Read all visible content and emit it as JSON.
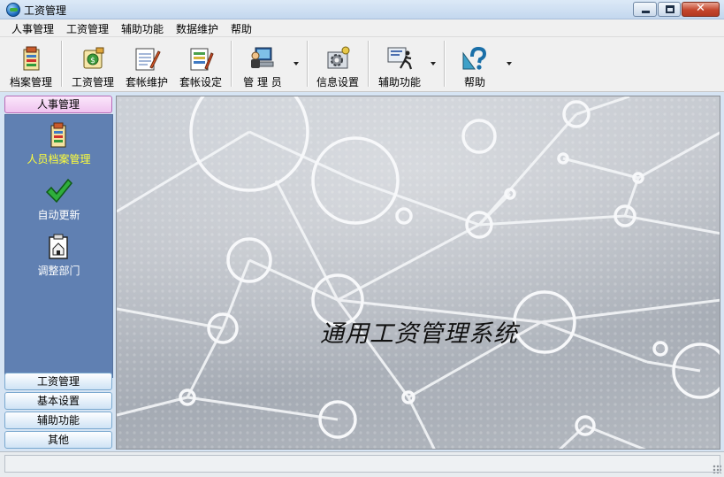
{
  "window": {
    "title": "工资管理",
    "close_glyph": "✕"
  },
  "menu": [
    "人事管理",
    "工资管理",
    "辅助功能",
    "数据维护",
    "帮助"
  ],
  "toolbar": {
    "buttons": [
      {
        "label": "档案管理",
        "icon": "file-cabinet-icon"
      },
      {
        "label": "工资管理",
        "icon": "cash-icon"
      },
      {
        "label": "套帐维护",
        "icon": "ledger-edit-icon"
      },
      {
        "label": "套帐设定",
        "icon": "ledger-setting-icon"
      },
      {
        "label": "管 理 员",
        "icon": "admin-computer-icon",
        "dropdown": true
      },
      {
        "label": "信息设置",
        "icon": "gear-settings-icon"
      },
      {
        "label": "辅助功能",
        "icon": "runner-icon",
        "dropdown": true
      },
      {
        "label": "帮助",
        "icon": "help-question-icon",
        "dropdown": true
      }
    ]
  },
  "sidebar": {
    "active_category": "人事管理",
    "items": [
      {
        "label": "人员档案管理",
        "icon": "personnel-file-icon",
        "selected": true
      },
      {
        "label": "自动更新",
        "icon": "checkmark-icon",
        "selected": false
      },
      {
        "label": "调整部门",
        "icon": "department-icon",
        "selected": false
      }
    ],
    "categories": [
      "工资管理",
      "基本设置",
      "辅助功能",
      "其他"
    ]
  },
  "main": {
    "system_title": "通用工资管理系统"
  },
  "colors": {
    "sidebar_panel": "#6080b2",
    "selected_text": "#ffff3a",
    "active_category": "#efc3ef"
  }
}
